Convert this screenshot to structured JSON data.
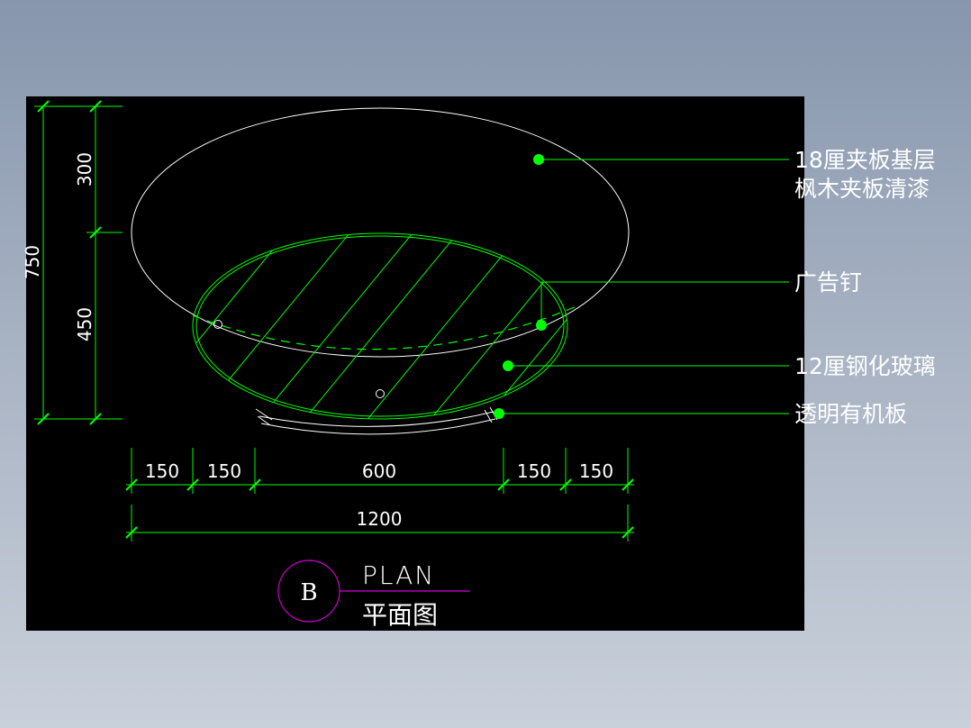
{
  "colors": {
    "background_top": "#8796ad",
    "canvas": "#000000",
    "dimension_line": "#00ff00",
    "outline": "#ffffff",
    "glass": "#00ff00",
    "title_circle": "#cc00cc"
  },
  "dimensions": {
    "vertical_total": "750",
    "vertical_top": "300",
    "vertical_bottom": "450",
    "horizontal_segments": [
      "150",
      "150",
      "600",
      "150",
      "150"
    ],
    "horizontal_total": "1200"
  },
  "callouts": [
    {
      "line1": "18厘夹板基层",
      "line2": "枫木夹板清漆"
    },
    {
      "line1": "广告钉"
    },
    {
      "line1": "12厘钢化玻璃"
    },
    {
      "line1": "透明有机板"
    }
  ],
  "title_block": {
    "letter": "B",
    "title_en": "PLAN",
    "title_cn": "平面图"
  }
}
